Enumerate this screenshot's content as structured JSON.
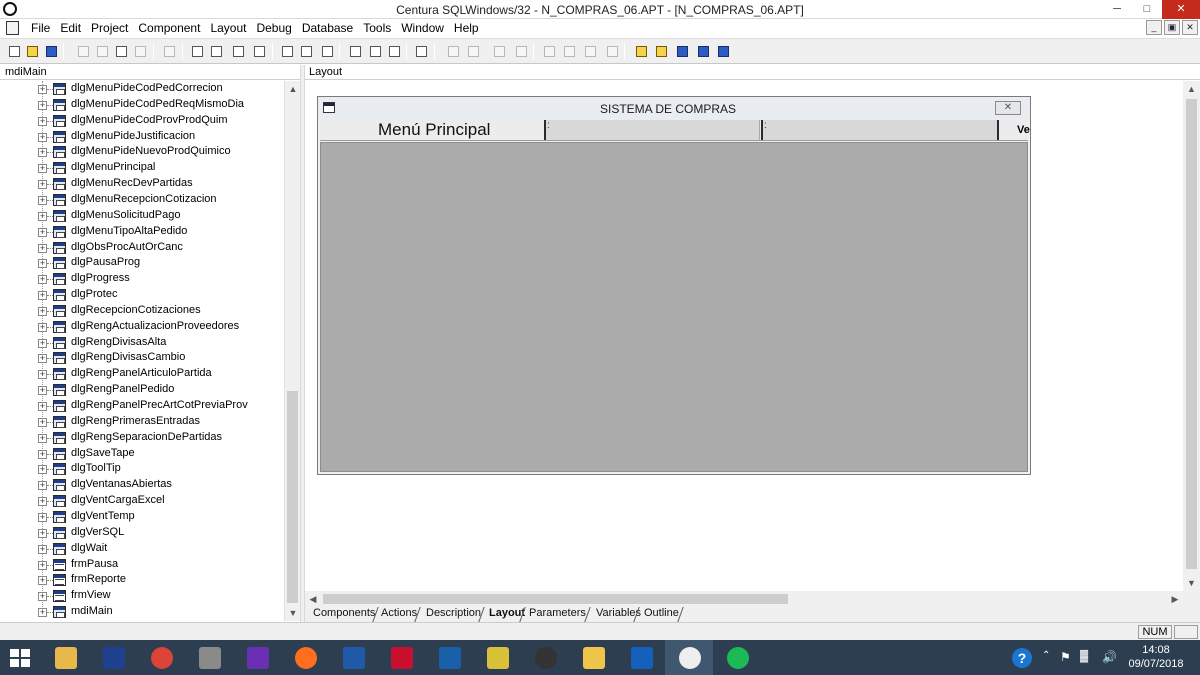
{
  "window": {
    "title": "Centura SQLWindows/32 - N_COMPRAS_06.APT - [N_COMPRAS_06.APT]",
    "minimize": "─",
    "maximize": "□",
    "close": "✕"
  },
  "menu": [
    "File",
    "Edit",
    "Project",
    "Component",
    "Layout",
    "Debug",
    "Database",
    "Tools",
    "Window",
    "Help"
  ],
  "mdi_buttons": [
    "_",
    "▣",
    "✕"
  ],
  "left_panel": {
    "header": "mdiMain",
    "items": [
      {
        "label": "dlgMenuPideCodPedCorrecion",
        "kind": "dlg"
      },
      {
        "label": "dlgMenuPideCodPedReqMismoDia",
        "kind": "dlg"
      },
      {
        "label": "dlgMenuPideCodProvProdQuim",
        "kind": "dlg"
      },
      {
        "label": "dlgMenuPideJustificacion",
        "kind": "dlg"
      },
      {
        "label": "dlgMenuPideNuevoProdQuimico",
        "kind": "dlg"
      },
      {
        "label": "dlgMenuPrincipal",
        "kind": "dlg"
      },
      {
        "label": "dlgMenuRecDevPartidas",
        "kind": "dlg"
      },
      {
        "label": "dlgMenuRecepcionCotizacion",
        "kind": "dlg"
      },
      {
        "label": "dlgMenuSolicitudPago",
        "kind": "dlg"
      },
      {
        "label": "dlgMenuTipoAltaPedido",
        "kind": "dlg"
      },
      {
        "label": "dlgObsProcAutOrCanc",
        "kind": "dlg"
      },
      {
        "label": "dlgPausaProg",
        "kind": "dlg"
      },
      {
        "label": "dlgProgress",
        "kind": "dlg"
      },
      {
        "label": "dlgProtec",
        "kind": "dlg"
      },
      {
        "label": "dlgRecepcionCotizaciones",
        "kind": "dlg"
      },
      {
        "label": "dlgRengActualizacionProveedores",
        "kind": "dlg"
      },
      {
        "label": "dlgRengDivisasAlta",
        "kind": "dlg"
      },
      {
        "label": "dlgRengDivisasCambio",
        "kind": "dlg"
      },
      {
        "label": "dlgRengPanelArticuloPartida",
        "kind": "dlg"
      },
      {
        "label": "dlgRengPanelPedido",
        "kind": "dlg"
      },
      {
        "label": "dlgRengPanelPrecArtCotPreviaProv",
        "kind": "dlg"
      },
      {
        "label": "dlgRengPrimerasEntradas",
        "kind": "dlg"
      },
      {
        "label": "dlgRengSeparacionDePartidas",
        "kind": "dlg"
      },
      {
        "label": "dlgSaveTape",
        "kind": "dlg"
      },
      {
        "label": "dlgToolTip",
        "kind": "dlg"
      },
      {
        "label": "dlgVentanasAbiertas",
        "kind": "dlg"
      },
      {
        "label": "dlgVentCargaExcel",
        "kind": "dlg"
      },
      {
        "label": "dlgVentTemp",
        "kind": "dlg"
      },
      {
        "label": "dlgVerSQL",
        "kind": "dlg"
      },
      {
        "label": "dlgWait",
        "kind": "dlg"
      },
      {
        "label": "frmPausa",
        "kind": "frm"
      },
      {
        "label": "frmReporte",
        "kind": "frm"
      },
      {
        "label": "frmView",
        "kind": "frm"
      },
      {
        "label": "mdiMain",
        "kind": "mdi"
      }
    ],
    "expand_glyph": "+",
    "scroll_up": "▲",
    "scroll_down": "▼"
  },
  "right_panel": {
    "header": "Layout",
    "scroll_up": "▲",
    "scroll_down": "▼",
    "scroll_left": "◀",
    "scroll_right": "▶"
  },
  "dialog": {
    "title": "SISTEMA DE COMPRAS",
    "close": "✕",
    "menu_label": "Menú Principal",
    "truncated_text": "Ve"
  },
  "tabs": [
    {
      "label": "Components",
      "active": false
    },
    {
      "label": "Actions",
      "active": false
    },
    {
      "label": "Description",
      "active": false
    },
    {
      "label": "Layout",
      "active": true
    },
    {
      "label": "Parameters",
      "active": false
    },
    {
      "label": "Variables",
      "active": false
    },
    {
      "label": "Outline",
      "active": false
    }
  ],
  "status": {
    "num": "NUM"
  },
  "taskbar": {
    "apps": [
      "file-explorer",
      "centura-sql",
      "chrome",
      "settings",
      "visual-studio",
      "firefox",
      "outlook",
      "filezilla",
      "wireshark",
      "network-tool",
      "camera",
      "folder",
      "virtualbox",
      "centura",
      "spotify"
    ],
    "tray": {
      "help": "?",
      "time": "14:08",
      "date": "09/07/2018"
    }
  },
  "colors": {
    "accent_close": "#c42b1c",
    "taskbar": "#2c3e50",
    "canvas_gray": "#ababab"
  }
}
